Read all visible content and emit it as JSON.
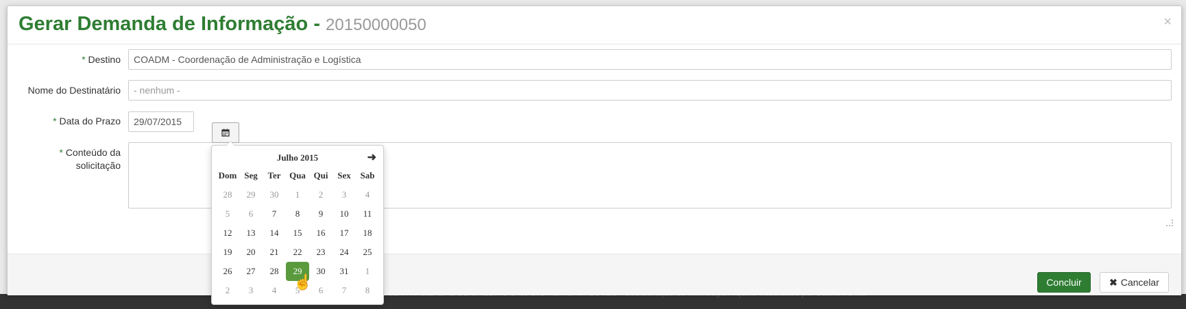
{
  "backdrop": {
    "row_text": "DESCENTRALIZADAS DE CRÉDITO    1459/201    MEMORIA    COTEC - Coordenação de Tecnologia    Arquivo visualizado por Guarani Ohta"
  },
  "modal": {
    "title": "Gerar Demanda de Informação -",
    "code": "20150000050",
    "close_glyph": "×"
  },
  "form": {
    "destino": {
      "required": "*",
      "label": "Destino",
      "value": "COADM - Coordenação de Administração e Logística"
    },
    "nome_destinatario": {
      "label": "Nome do Destinatário",
      "placeholder": "- nenhum -"
    },
    "data_prazo": {
      "required": "*",
      "label": "Data do Prazo",
      "value": "29/07/2015"
    },
    "conteudo": {
      "required": "*",
      "label_line1": "Conteúdo da",
      "label_line2": "solicitação"
    }
  },
  "datepicker": {
    "month_label": "Julho 2015",
    "next_glyph": "➜",
    "weekdays": [
      "Dom",
      "Seg",
      "Ter",
      "Qua",
      "Qui",
      "Sex",
      "Sab"
    ],
    "weeks": [
      [
        "28",
        "29",
        "30",
        "1",
        "2",
        "3",
        "4"
      ],
      [
        "5",
        "6",
        "7",
        "8",
        "9",
        "10",
        "11"
      ],
      [
        "12",
        "13",
        "14",
        "15",
        "16",
        "17",
        "18"
      ],
      [
        "19",
        "20",
        "21",
        "22",
        "23",
        "24",
        "25"
      ],
      [
        "26",
        "27",
        "28",
        "29",
        "30",
        "31",
        "1"
      ],
      [
        "2",
        "3",
        "4",
        "5",
        "6",
        "7",
        "8"
      ]
    ],
    "selected_day": "29"
  },
  "footer": {
    "submit_label": "Concluir",
    "cancel_icon": "✖",
    "cancel_label": "Cancelar"
  },
  "colors": {
    "accent": "#2e7d32",
    "selected_day_bg": "#5a9a3d"
  }
}
